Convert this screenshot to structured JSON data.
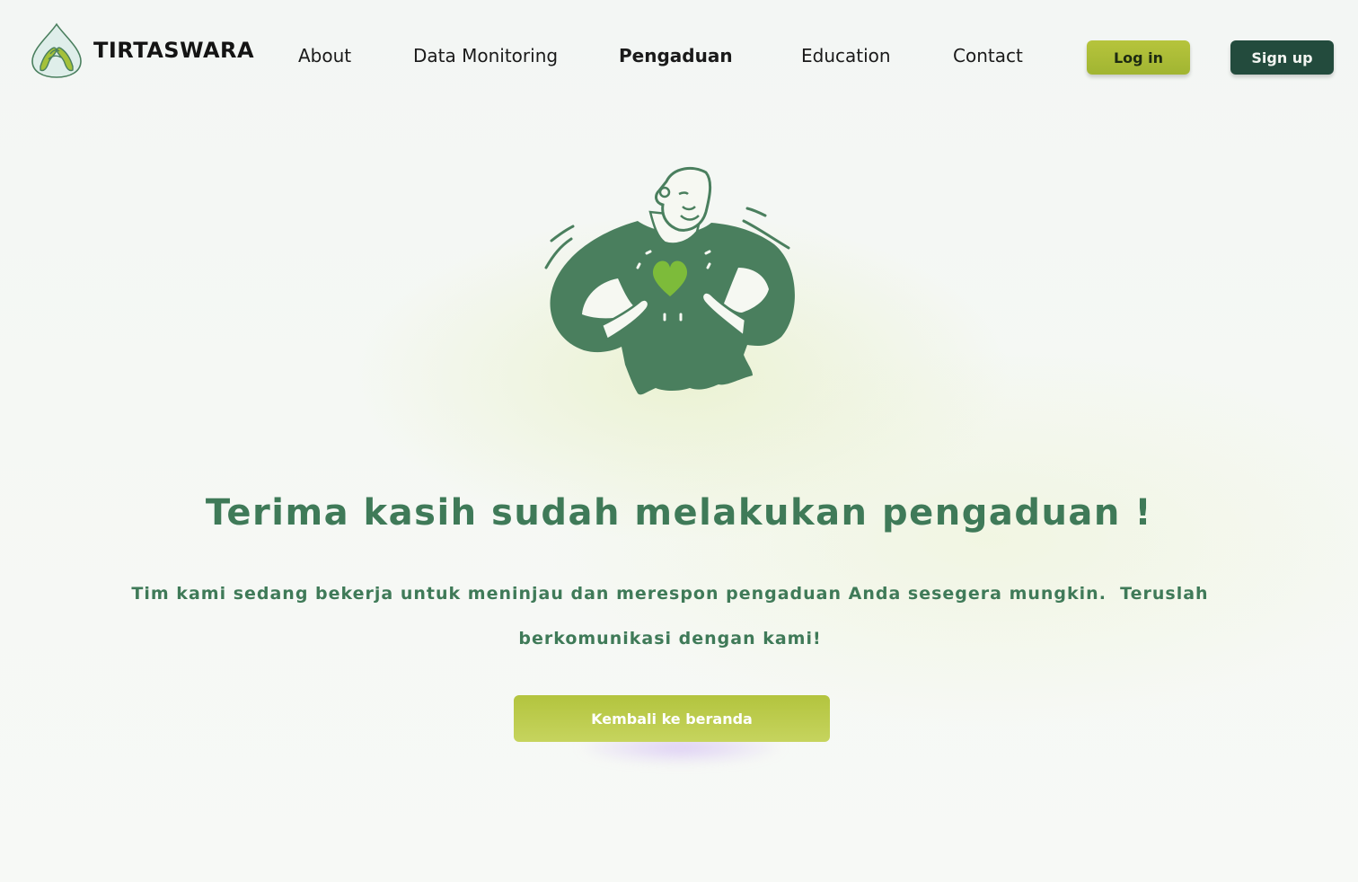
{
  "brand": {
    "name": "TIRTASWARA",
    "logo_icon": "water-drop-hands-icon"
  },
  "nav": {
    "items": [
      {
        "label": "About"
      },
      {
        "label": "Data Monitoring"
      },
      {
        "label": "Pengaduan",
        "active": true
      },
      {
        "label": "Education"
      },
      {
        "label": "Contact"
      }
    ],
    "login_label": "Log in",
    "signup_label": "Sign up"
  },
  "hero": {
    "illustration_icon": "person-heart-illustration",
    "title": "Terima kasih sudah melakukan pengaduan !",
    "message_line1": "Tim kami sedang bekerja untuk meninjau dan merespon pengaduan Anda sesegera mungkin.  Teruslah",
    "message_line2": "berkomunikasi dengan kami!",
    "cta_label": "Kembali ke beranda"
  },
  "colors": {
    "brand_green": "#3f7a58",
    "illustration_green": "#4a7f5e",
    "heart_green": "#7dbb3a",
    "lime": "#b3c43e",
    "dark_green": "#234b3d"
  }
}
